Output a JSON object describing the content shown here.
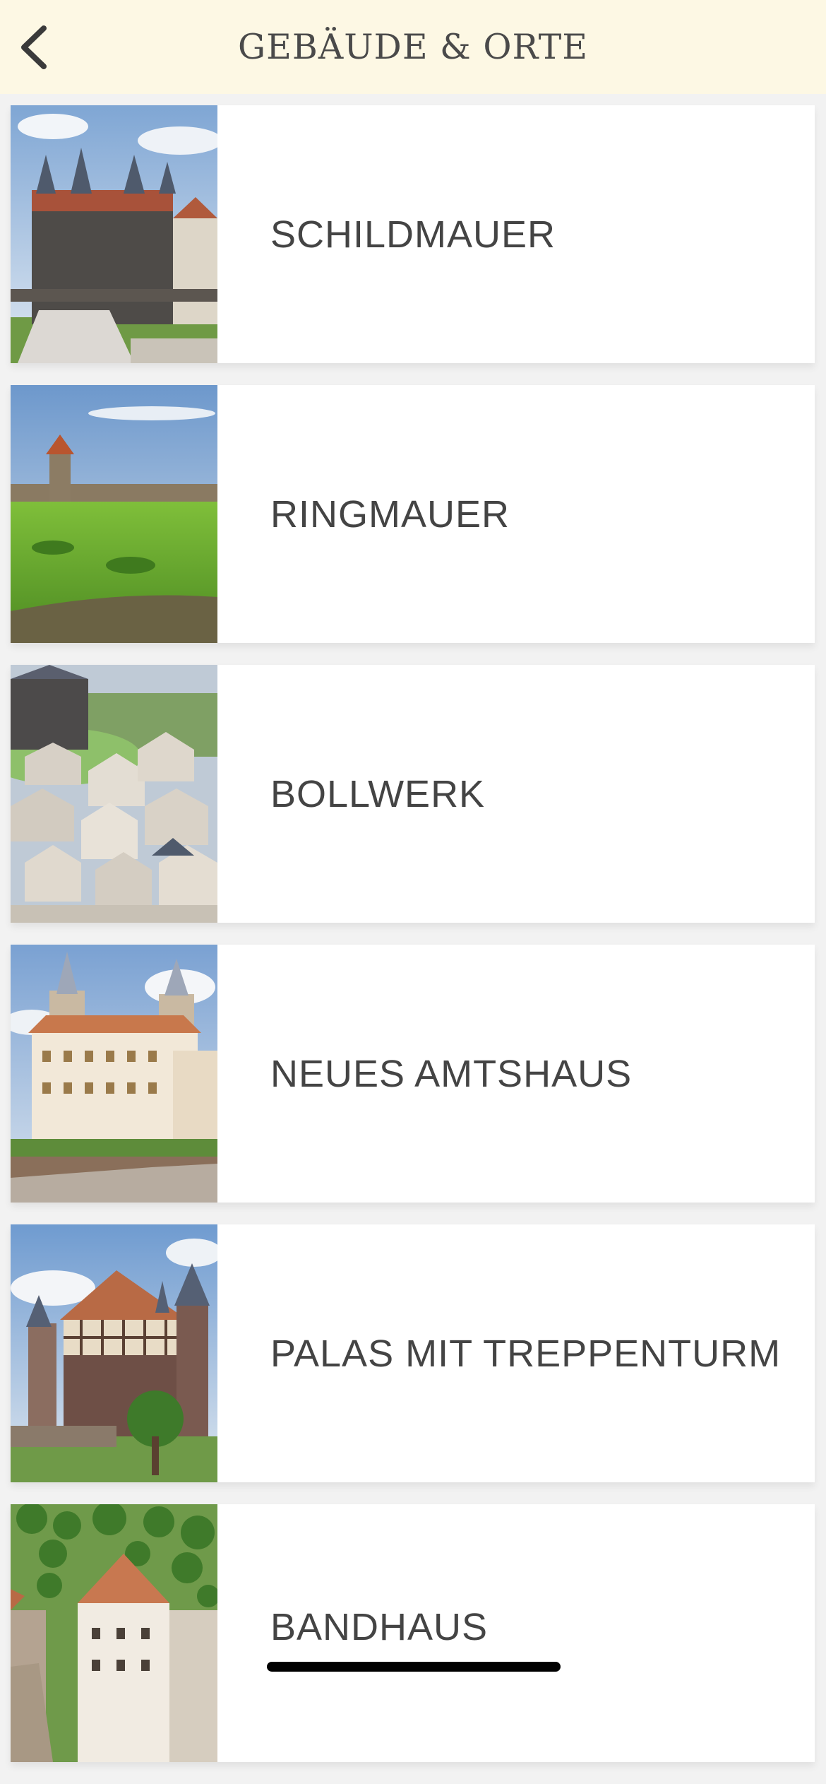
{
  "header": {
    "title": "GEBÄUDE & ORTE",
    "back_icon": "chevron-left-icon"
  },
  "items": [
    {
      "label": "SCHILDMAUER",
      "image": "schildmauer-photo"
    },
    {
      "label": "RINGMAUER",
      "image": "ringmauer-photo"
    },
    {
      "label": "BOLLWERK",
      "image": "bollwerk-photo"
    },
    {
      "label": "NEUES AMTSHAUS",
      "image": "neues-amtshaus-photo"
    },
    {
      "label": "PALAS MIT TREPPENTURM",
      "image": "palas-photo"
    },
    {
      "label": "BANDHAUS",
      "image": "bandhaus-photo"
    }
  ],
  "colors": {
    "header_bg": "#fdf8e4",
    "page_bg": "#f2f2f2",
    "card_bg": "#ffffff",
    "text": "#444444"
  }
}
